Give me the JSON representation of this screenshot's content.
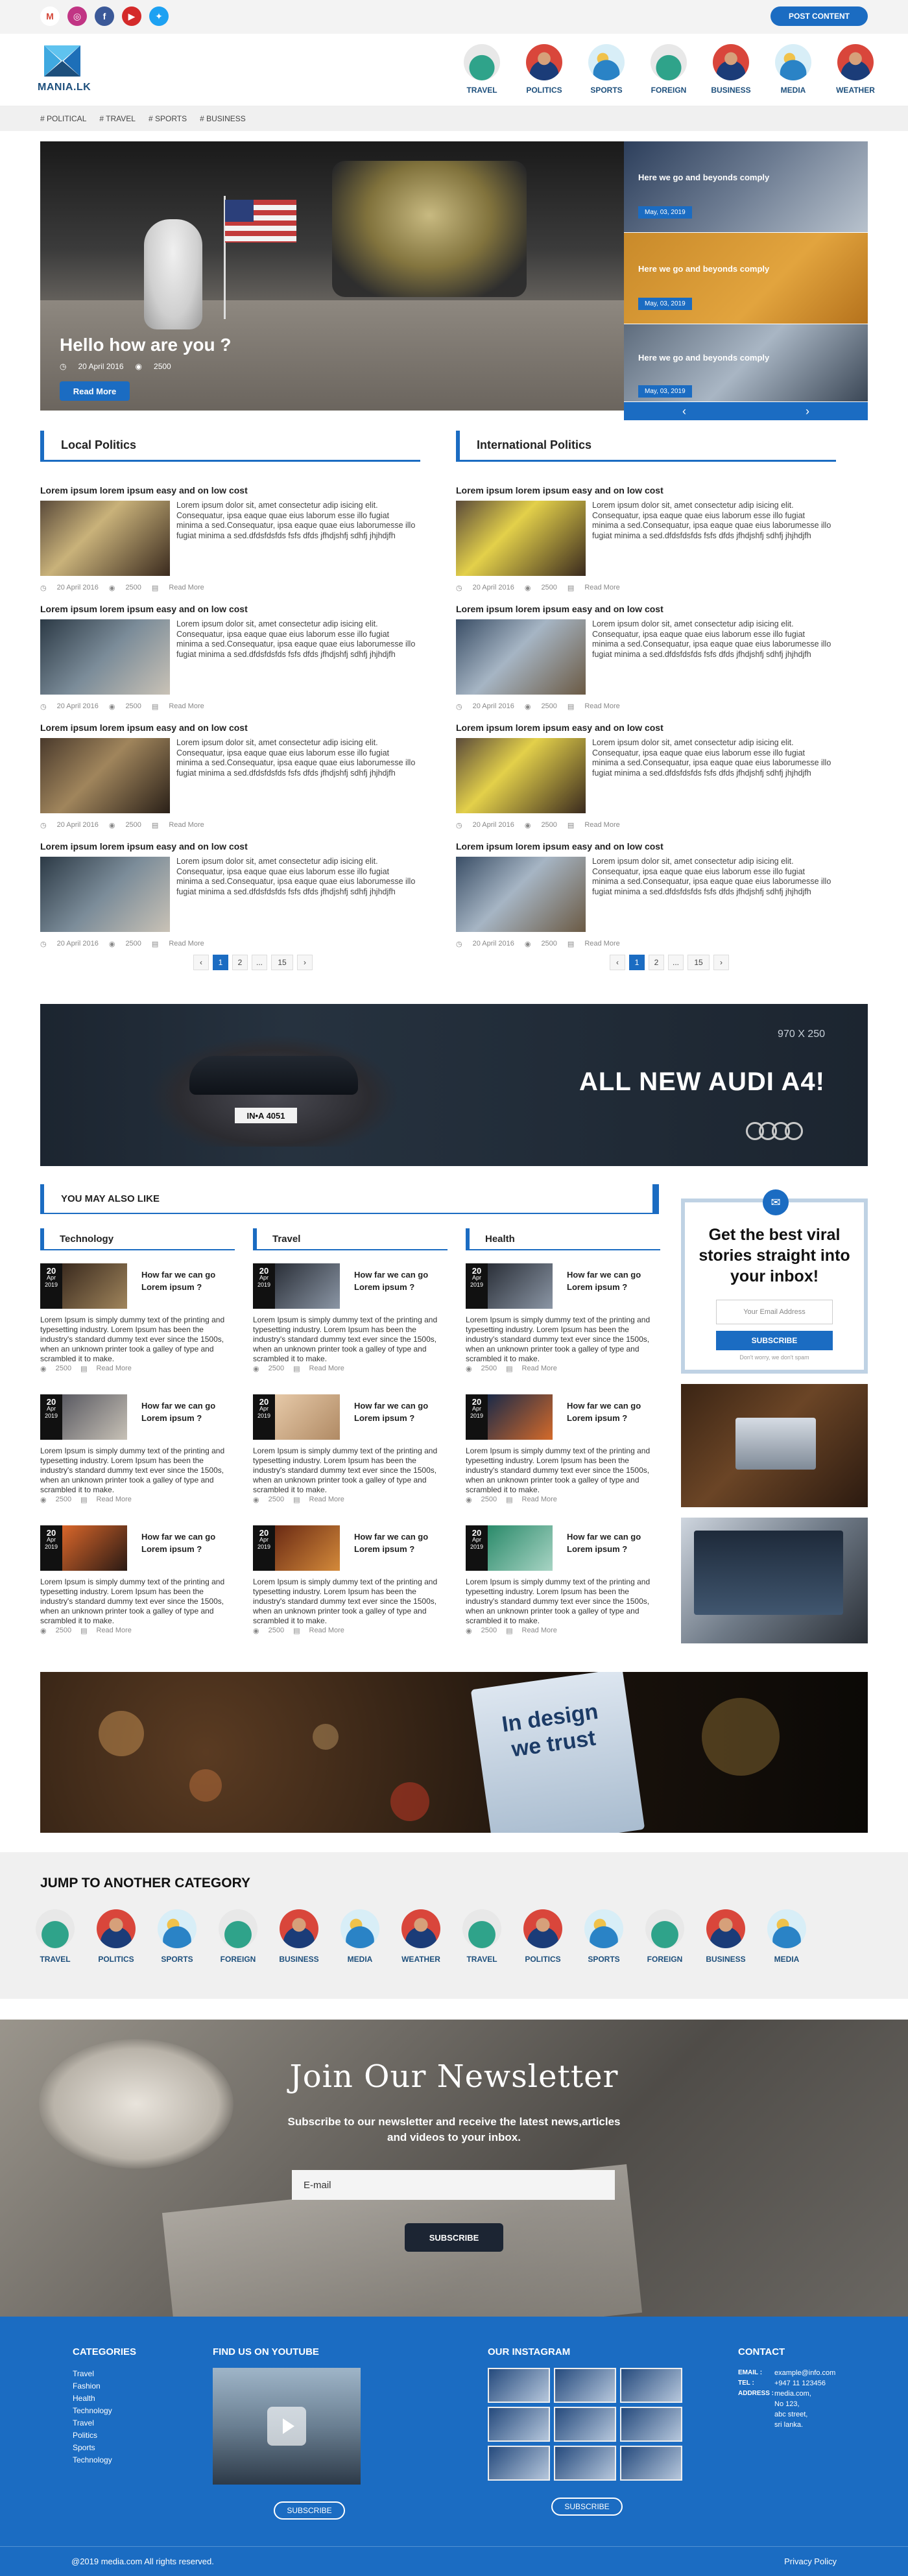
{
  "topbar": {
    "social": [
      {
        "name": "gmail-icon",
        "glyph": "M",
        "bg": "#ffffff",
        "fg": "#d44638"
      },
      {
        "name": "instagram-icon",
        "glyph": "◎",
        "bg": "#c13584",
        "fg": "#ffffff"
      },
      {
        "name": "facebook-icon",
        "glyph": "f",
        "bg": "#3b5998",
        "fg": "#ffffff"
      },
      {
        "name": "youtube-icon",
        "glyph": "▶",
        "bg": "#d42a2a",
        "fg": "#ffffff"
      },
      {
        "name": "twitter-icon",
        "glyph": "✦",
        "bg": "#1da1f2",
        "fg": "#ffffff"
      }
    ],
    "post_label": "POST CONTENT"
  },
  "logo": {
    "name": "MANIA.LK"
  },
  "categories": [
    "TRAVEL",
    "POLITICS",
    "SPORTS",
    "FOREIGN",
    "BUSINESS",
    "MEDIA",
    "WEATHER"
  ],
  "tags": [
    "# POLITICAL",
    "# TRAVEL",
    "# SPORTS",
    "# BUSINESS"
  ],
  "hero": {
    "title": "Hello how are you ?",
    "date": "20 April 2016",
    "views": "2500",
    "button": "Read More",
    "side": [
      {
        "title": "Here we go and beyonds comply",
        "date": "May, 03, 2019"
      },
      {
        "title": "Here we go and beyonds comply",
        "date": "May, 03, 2019"
      },
      {
        "title": "Here we go and beyonds comply",
        "date": "May, 03, 2019"
      }
    ],
    "prev": "‹",
    "next": "›"
  },
  "local": {
    "heading": "Local Politics",
    "posts": [
      {
        "title": "Lorem ipsum lorem ipsum easy and on low cost",
        "text": "Lorem ipsum dolor sit, amet consectetur adip isicing elit. Consequatur, ipsa eaque quae eius laborum esse illo fugiat minima a sed.Consequatur, ipsa eaque quae eius laborumesse illo fugiat minima a sed.dfdsfdsfds fsfs dfds jfhdjshfj sdhfj jhjhdjfh",
        "date": "20 April 2016",
        "views": "2500",
        "read": "Read More"
      },
      {
        "title": "Lorem ipsum lorem ipsum easy and on low cost",
        "text": "Lorem ipsum dolor sit, amet consectetur adip isicing elit. Consequatur, ipsa eaque quae eius laborum esse illo fugiat minima a sed.Consequatur, ipsa eaque quae eius laborumesse illo fugiat minima a sed.dfdsfdsfds fsfs dfds jfhdjshfj sdhfj jhjhdjfh",
        "date": "20 April 2016",
        "views": "2500",
        "read": "Read More"
      },
      {
        "title": "Lorem ipsum lorem ipsum easy and on low cost",
        "text": "Lorem ipsum dolor sit, amet consectetur adip isicing elit. Consequatur, ipsa eaque quae eius laborum esse illo fugiat minima a sed.Consequatur, ipsa eaque quae eius laborumesse illo fugiat minima a sed.dfdsfdsfds fsfs dfds jfhdjshfj sdhfj jhjhdjfh",
        "date": "20 April 2016",
        "views": "2500",
        "read": "Read More"
      },
      {
        "title": "Lorem ipsum lorem ipsum easy and on low cost",
        "text": "Lorem ipsum dolor sit, amet consectetur adip isicing elit. Consequatur, ipsa eaque quae eius laborum esse illo fugiat minima a sed.Consequatur, ipsa eaque quae eius laborumesse illo fugiat minima a sed.dfdsfdsfds fsfs dfds jfhdjshfj sdhfj jhjhdjfh",
        "date": "20 April 2016",
        "views": "2500",
        "read": "Read More"
      }
    ]
  },
  "international": {
    "heading": "International Politics",
    "posts": [
      {
        "title": "Lorem ipsum lorem ipsum easy and on low cost",
        "text": "Lorem ipsum dolor sit, amet consectetur adip isicing elit. Consequatur, ipsa eaque quae eius laborum esse illo fugiat minima a sed.Consequatur, ipsa eaque quae eius laborumesse illo fugiat minima a sed.dfdsfdsfds fsfs dfds jfhdjshfj sdhfj jhjhdjfh",
        "date": "20 April 2016",
        "views": "2500",
        "read": "Read More"
      },
      {
        "title": "Lorem ipsum lorem ipsum easy and on low cost",
        "text": "Lorem ipsum dolor sit, amet consectetur adip isicing elit. Consequatur, ipsa eaque quae eius laborum esse illo fugiat minima a sed.Consequatur, ipsa eaque quae eius laborumesse illo fugiat minima a sed.dfdsfdsfds fsfs dfds jfhdjshfj sdhfj jhjhdjfh",
        "date": "20 April 2016",
        "views": "2500",
        "read": "Read More"
      },
      {
        "title": "Lorem ipsum lorem ipsum easy and on low cost",
        "text": "Lorem ipsum dolor sit, amet consectetur adip isicing elit. Consequatur, ipsa eaque quae eius laborum esse illo fugiat minima a sed.Consequatur, ipsa eaque quae eius laborumesse illo fugiat minima a sed.dfdsfdsfds fsfs dfds jfhdjshfj sdhfj jhjhdjfh",
        "date": "20 April 2016",
        "views": "2500",
        "read": "Read More"
      },
      {
        "title": "Lorem ipsum lorem ipsum easy and on low cost",
        "text": "Lorem ipsum dolor sit, amet consectetur adip isicing elit. Consequatur, ipsa eaque quae eius laborum esse illo fugiat minima a sed.Consequatur, ipsa eaque quae eius laborumesse illo fugiat minima a sed.dfdsfdsfds fsfs dfds jfhdjshfj sdhfj jhjhdjfh",
        "date": "20 April 2016",
        "views": "2500",
        "read": "Read More"
      }
    ]
  },
  "pager": {
    "prev": "‹",
    "p1": "1",
    "p2": "2",
    "dots": "...",
    "last": "15",
    "next": "›"
  },
  "ad": {
    "size": "970 X 250",
    "headline": "ALL NEW AUDI A4!",
    "plate": "IN•A 4051"
  },
  "yml": {
    "heading": "YOU MAY ALSO LIKE",
    "columns": [
      {
        "title": "Technology",
        "items": [
          {
            "day": "20",
            "month": "Apr",
            "year": "2019",
            "title": "How far we can go Lorem ipsum ?",
            "text": "Lorem Ipsum is simply dummy text of the printing and typesetting industry. Lorem Ipsum has been the industry's standard dummy text ever since the 1500s, when an unknown printer took a galley of type and scrambled it to make.",
            "views": "2500",
            "read": "Read More"
          },
          {
            "day": "20",
            "month": "Apr",
            "year": "2019",
            "title": "How far we can go Lorem ipsum ?",
            "text": "Lorem Ipsum is simply dummy text of the printing and typesetting industry. Lorem Ipsum has been the industry's standard dummy text ever since the 1500s, when an unknown printer took a galley of type and scrambled it to make.",
            "views": "2500",
            "read": "Read More"
          },
          {
            "day": "20",
            "month": "Apr",
            "year": "2019",
            "title": "How far we can go Lorem ipsum ?",
            "text": "Lorem Ipsum is simply dummy text of the printing and typesetting industry. Lorem Ipsum has been the industry's standard dummy text ever since the 1500s, when an unknown printer took a galley of type and scrambled it to make.",
            "views": "2500",
            "read": "Read More"
          }
        ]
      },
      {
        "title": "Travel",
        "items": [
          {
            "day": "20",
            "month": "Apr",
            "year": "2019",
            "title": "How far we can go Lorem ipsum ?",
            "text": "Lorem Ipsum is simply dummy text of the printing and typesetting industry. Lorem Ipsum has been the industry's standard dummy text ever since the 1500s, when an unknown printer took a galley of type and scrambled it to make.",
            "views": "2500",
            "read": "Read More"
          },
          {
            "day": "20",
            "month": "Apr",
            "year": "2019",
            "title": "How far we can go Lorem ipsum ?",
            "text": "Lorem Ipsum is simply dummy text of the printing and typesetting industry. Lorem Ipsum has been the industry's standard dummy text ever since the 1500s, when an unknown printer took a galley of type and scrambled it to make.",
            "views": "2500",
            "read": "Read More"
          },
          {
            "day": "20",
            "month": "Apr",
            "year": "2019",
            "title": "How far we can go Lorem ipsum ?",
            "text": "Lorem Ipsum is simply dummy text of the printing and typesetting industry. Lorem Ipsum has been the industry's standard dummy text ever since the 1500s, when an unknown printer took a galley of type and scrambled it to make.",
            "views": "2500",
            "read": "Read More"
          }
        ]
      },
      {
        "title": "Health",
        "items": [
          {
            "day": "20",
            "month": "Apr",
            "year": "2019",
            "title": "How far we can go Lorem ipsum ?",
            "text": "Lorem Ipsum is simply dummy text of the printing and typesetting industry. Lorem Ipsum has been the industry's standard dummy text ever since the 1500s, when an unknown printer took a galley of type and scrambled it to make.",
            "views": "2500",
            "read": "Read More"
          },
          {
            "day": "20",
            "month": "Apr",
            "year": "2019",
            "title": "How far we can go Lorem ipsum ?",
            "text": "Lorem Ipsum is simply dummy text of the printing and typesetting industry. Lorem Ipsum has been the industry's standard dummy text ever since the 1500s, when an unknown printer took a galley of type and scrambled it to make.",
            "views": "2500",
            "read": "Read More"
          },
          {
            "day": "20",
            "month": "Apr",
            "year": "2019",
            "title": "How far we can go Lorem ipsum ?",
            "text": "Lorem Ipsum is simply dummy text of the printing and typesetting industry. Lorem Ipsum has been the industry's standard dummy text ever since the 1500s, when an unknown printer took a galley of type and scrambled it to make.",
            "views": "2500",
            "read": "Read More"
          }
        ]
      }
    ]
  },
  "sidebar_newsletter": {
    "title": "Get the best viral stories straight into your inbox!",
    "placeholder": "Your Email Address",
    "button": "SUBSCRIBE",
    "note": "Don't worry, we don't spam"
  },
  "banner": {
    "sign": "In design we trust"
  },
  "jump": {
    "heading": "JUMP TO ANOTHER CATEGORY",
    "items": [
      "TRAVEL",
      "POLITICS",
      "SPORTS",
      "FOREIGN",
      "BUSINESS",
      "MEDIA",
      "WEATHER",
      "TRAVEL",
      "POLITICS",
      "SPORTS",
      "FOREIGN",
      "BUSINESS",
      "MEDIA"
    ]
  },
  "newsletter": {
    "title": "Join Our Newsletter",
    "line1": "Subscribe to our newsletter and receive the latest news,articles",
    "line2": "and videos to your inbox.",
    "placeholder": "E-mail",
    "button": "SUBSCRIBE"
  },
  "footer": {
    "categories_title": "CATEGORIES",
    "categories": [
      "Travel",
      "Fashion",
      "Health",
      "Technology",
      "Travel",
      "Politics",
      "Sports",
      "Technology"
    ],
    "youtube_title": "FIND US ON YOUTUBE",
    "youtube_button": "SUBSCRIBE",
    "instagram_title": "OUR INSTAGRAM",
    "instagram_button": "SUBSCRIBE",
    "contact_title": "CONTACT",
    "email_label": "EMAIL :",
    "email": "example@info.com",
    "tel_label": "TEL :",
    "tel": "+947 11 123456",
    "address_label": "ADDRESS :",
    "address": [
      "media.com,",
      "No 123,",
      "abc street,",
      "sri lanka."
    ],
    "copyright": "@2019 media.com All rights reserved.",
    "privacy": "Privacy Policy"
  },
  "colors": {
    "brand": "#1b6cc2",
    "dark": "#1c2533"
  }
}
